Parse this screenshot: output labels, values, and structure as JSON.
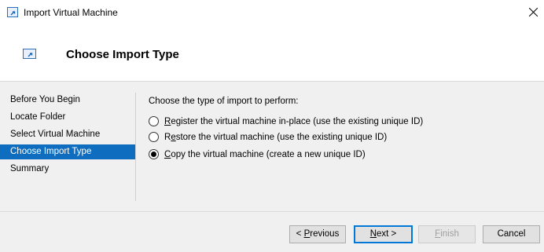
{
  "window": {
    "title": "Import Virtual Machine",
    "title_icon": "import-vm-icon"
  },
  "header": {
    "title": "Choose Import Type",
    "icon": "import-vm-icon"
  },
  "nav": {
    "items": [
      {
        "label": "Before You Begin",
        "active": false
      },
      {
        "label": "Locate Folder",
        "active": false
      },
      {
        "label": "Select Virtual Machine",
        "active": false
      },
      {
        "label": "Choose Import Type",
        "active": true
      },
      {
        "label": "Summary",
        "active": false
      }
    ]
  },
  "main": {
    "prompt": "Choose the type of import to perform:",
    "options": [
      {
        "accel": "R",
        "rest": "egister the virtual machine in-place (use the existing unique ID)",
        "selected": false
      },
      {
        "accel_prefix": "R",
        "accel": "e",
        "rest": "store the virtual machine (use the existing unique ID)",
        "selected": false
      },
      {
        "accel": "C",
        "rest": "opy the virtual machine (create a new unique ID)",
        "selected": true
      }
    ]
  },
  "buttons": {
    "previous": {
      "prefix": "< ",
      "accel": "P",
      "rest": "revious"
    },
    "next": {
      "accel": "N",
      "rest": "ext >"
    },
    "finish": {
      "accel": "F",
      "rest": "inish",
      "disabled": true
    },
    "cancel": "Cancel"
  },
  "colors": {
    "accent": "#0f6dbf",
    "default_border": "#0078d7"
  }
}
